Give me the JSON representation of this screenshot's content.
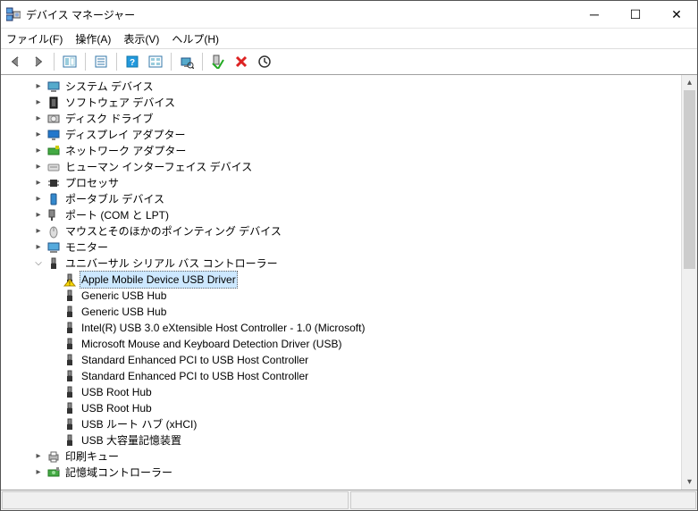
{
  "window": {
    "title": "デバイス マネージャー"
  },
  "menu": {
    "file": "ファイル(F)",
    "action": "操作(A)",
    "view": "表示(V)",
    "help": "ヘルプ(H)"
  },
  "categories": [
    {
      "id": "system",
      "label": "システム デバイス",
      "icon": "computer-icon",
      "exp": "▸"
    },
    {
      "id": "software",
      "label": "ソフトウェア デバイス",
      "icon": "chip-icon",
      "exp": "▸"
    },
    {
      "id": "disk",
      "label": "ディスク ドライブ",
      "icon": "drive-icon",
      "exp": "▸"
    },
    {
      "id": "display",
      "label": "ディスプレイ アダプター",
      "icon": "monitor-icon",
      "exp": "▸"
    },
    {
      "id": "network",
      "label": "ネットワーク アダプター",
      "icon": "netcard-icon",
      "exp": "▸"
    },
    {
      "id": "hid",
      "label": "ヒューマン インターフェイス デバイス",
      "icon": "hid-icon",
      "exp": "▸"
    },
    {
      "id": "cpu",
      "label": "プロセッサ",
      "icon": "cpu-icon",
      "exp": "▸"
    },
    {
      "id": "portable",
      "label": "ポータブル デバイス",
      "icon": "portable-icon",
      "exp": "▸"
    },
    {
      "id": "ports",
      "label": "ポート (COM と LPT)",
      "icon": "port-icon",
      "exp": "▸"
    },
    {
      "id": "mouse",
      "label": "マウスとそのほかのポインティング デバイス",
      "icon": "mouse-icon",
      "exp": "▸"
    },
    {
      "id": "monitor",
      "label": "モニター",
      "icon": "monitor2-icon",
      "exp": "▸"
    }
  ],
  "usb_category": {
    "label": "ユニバーサル シリアル バス コントローラー",
    "exp": "⌵"
  },
  "usb_children": [
    {
      "label": "Apple Mobile Device USB Driver",
      "selected": true,
      "warn": true
    },
    {
      "label": "Generic USB Hub"
    },
    {
      "label": "Generic USB Hub"
    },
    {
      "label": "Intel(R) USB 3.0 eXtensible Host Controller - 1.0 (Microsoft)"
    },
    {
      "label": "Microsoft Mouse and Keyboard Detection Driver (USB)"
    },
    {
      "label": "Standard Enhanced PCI to USB Host Controller"
    },
    {
      "label": "Standard Enhanced PCI to USB Host Controller"
    },
    {
      "label": "USB Root Hub"
    },
    {
      "label": "USB Root Hub"
    },
    {
      "label": "USB ルート ハブ (xHCI)"
    },
    {
      "label": "USB 大容量記憶装置"
    }
  ],
  "tail": [
    {
      "id": "printq",
      "label": "印刷キュー",
      "icon": "printer-icon",
      "exp": "▸"
    },
    {
      "id": "storage",
      "label": "記憶域コントローラー",
      "icon": "storage-icon",
      "exp": "▸"
    }
  ]
}
